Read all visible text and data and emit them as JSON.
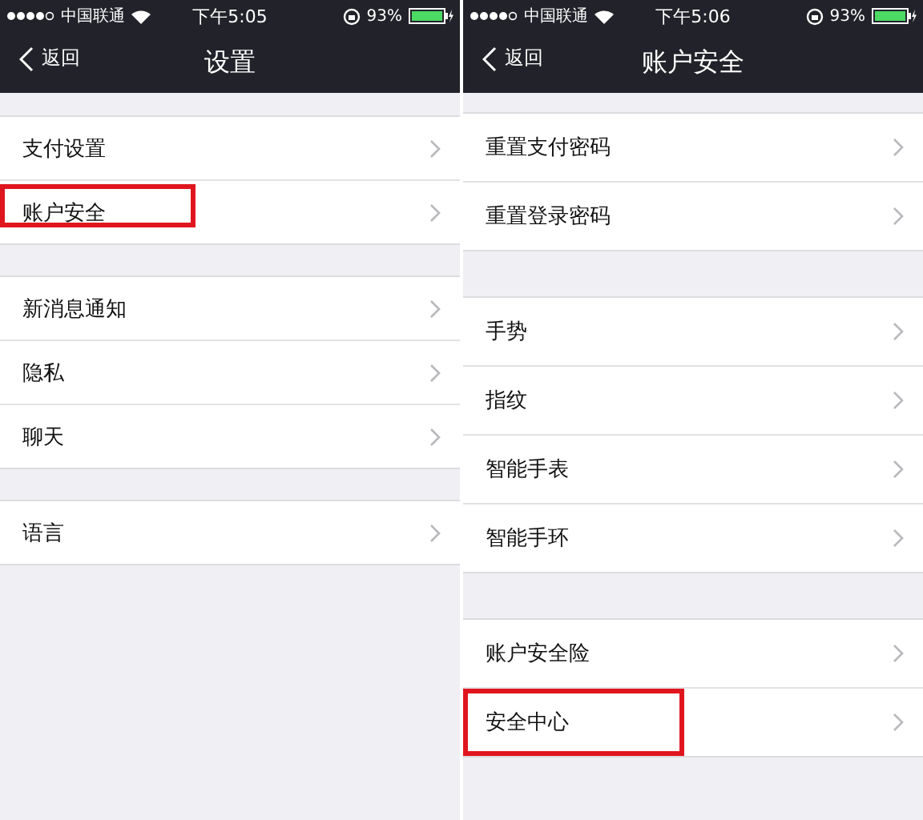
{
  "screens": [
    {
      "status": {
        "carrier": "中国联通",
        "time": "下午5:05",
        "battery": "93%"
      },
      "nav": {
        "back": "返回",
        "title": "设置"
      },
      "groups": [
        {
          "items": [
            {
              "label": "支付设置",
              "highlighted": false
            },
            {
              "label": "账户安全",
              "highlighted": true
            }
          ]
        },
        {
          "items": [
            {
              "label": "新消息通知",
              "highlighted": false
            },
            {
              "label": "隐私",
              "highlighted": false
            },
            {
              "label": "聊天",
              "highlighted": false
            }
          ]
        },
        {
          "items": [
            {
              "label": "语言",
              "highlighted": false
            }
          ]
        }
      ]
    },
    {
      "status": {
        "carrier": "中国联通",
        "time": "下午5:06",
        "battery": "93%"
      },
      "nav": {
        "back": "返回",
        "title": "账户安全"
      },
      "groups": [
        {
          "items": [
            {
              "label": "重置支付密码",
              "highlighted": false
            },
            {
              "label": "重置登录密码",
              "highlighted": false
            }
          ]
        },
        {
          "items": [
            {
              "label": "手势",
              "highlighted": false
            },
            {
              "label": "指纹",
              "highlighted": false
            },
            {
              "label": "智能手表",
              "highlighted": false
            },
            {
              "label": "智能手环",
              "highlighted": false
            }
          ]
        },
        {
          "items": [
            {
              "label": "账户安全险",
              "highlighted": false
            },
            {
              "label": "安全中心",
              "highlighted": true
            }
          ]
        }
      ]
    }
  ]
}
